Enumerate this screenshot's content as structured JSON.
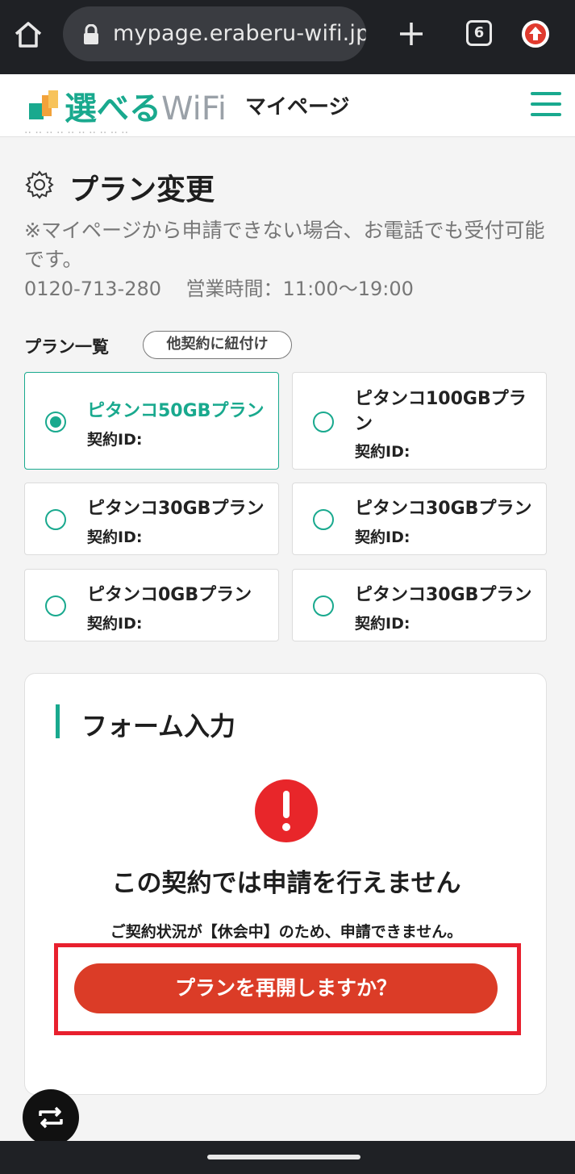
{
  "browser": {
    "url": "mypage.eraberu-wifi.jp/s",
    "tab_count": "6"
  },
  "header": {
    "logo_part1": "選べる",
    "logo_part2": "Wi",
    "logo_part3": "Fi",
    "title": "マイページ"
  },
  "page": {
    "title": "プラン変更",
    "notice": "※マイページから申請できない場合、お電話でも受付可能です。",
    "phone": "0120-713-280",
    "hours": "営業時間：11:00〜19:00"
  },
  "plans": {
    "label": "プラン一覧",
    "link_button": "他契約に紐付け",
    "items": [
      {
        "name": "ピタンコ50GBプラン",
        "id_label": "契約ID:",
        "selected": true
      },
      {
        "name": "ピタンコ100GBプラン",
        "id_label": "契約ID:",
        "selected": false
      },
      {
        "name": "ピタンコ30GBプラン",
        "id_label": "契約ID:",
        "selected": false
      },
      {
        "name": "ピタンコ30GBプラン",
        "id_label": "契約ID:",
        "selected": false
      },
      {
        "name": "ピタンコ0GBプラン",
        "id_label": "契約ID:",
        "selected": false
      },
      {
        "name": "ピタンコ30GBプラン",
        "id_label": "契約ID:",
        "selected": false
      }
    ]
  },
  "form": {
    "title": "フォーム入力",
    "error_title": "この契約では申請を行えません",
    "error_desc": "ご契約状況が【休会中】のため、申請できません。",
    "button_label": "プランを再開しますか？"
  },
  "colors": {
    "accent": "#19a98e",
    "button": "#db3c27",
    "alert": "#e8262a",
    "highlight": "#e8202e"
  },
  "icons": [
    "home-icon",
    "lock-icon",
    "plus-icon",
    "tabs-icon",
    "update-icon",
    "gear-icon",
    "alert-icon",
    "repeat-icon"
  ]
}
